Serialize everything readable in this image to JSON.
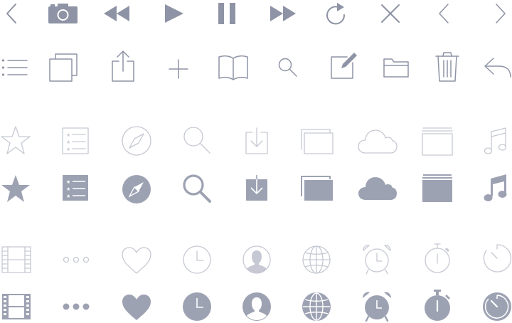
{
  "colors": {
    "toolbar_icon": "#8e93a5",
    "outline_icon": "#c6c9d3",
    "solid_icon": "#9da2b3",
    "background": "#ffffff"
  },
  "toolbar_row_1": [
    "back-chevron-icon",
    "camera-icon",
    "rewind-icon",
    "play-icon",
    "pause-icon",
    "fast-forward-icon",
    "refresh-icon",
    "close-icon",
    "chevron-left-icon",
    "chevron-right-icon"
  ],
  "toolbar_row_2": [
    "list-icon",
    "copy-icon",
    "share-icon",
    "add-icon",
    "book-icon",
    "search-icon",
    "compose-icon",
    "folder-icon",
    "trash-icon",
    "reply-icon"
  ],
  "tab_row_outline_1": [
    "star-outline-icon",
    "list-rated-outline-icon",
    "compass-outline-icon",
    "search-outline-icon",
    "download-outline-icon",
    "windows-outline-icon",
    "cloud-outline-icon",
    "stack-outline-icon",
    "music-outline-icon"
  ],
  "tab_row_filled_1": [
    "star-filled-icon",
    "list-rated-filled-icon",
    "compass-filled-icon",
    "search-filled-icon",
    "download-filled-icon",
    "windows-filled-icon",
    "cloud-filled-icon",
    "stack-filled-icon",
    "music-filled-icon"
  ],
  "tab_row_outline_2": [
    "film-outline-icon",
    "more-outline-icon",
    "heart-outline-icon",
    "clock-outline-icon",
    "contact-outline-icon",
    "globe-outline-icon",
    "alarm-outline-icon",
    "stopwatch-outline-icon",
    "timer-outline-icon"
  ],
  "tab_row_filled_2": [
    "film-filled-icon",
    "more-filled-icon",
    "heart-filled-icon",
    "clock-filled-icon",
    "contact-filled-icon",
    "globe-filled-icon",
    "alarm-filled-icon",
    "stopwatch-filled-icon",
    "timer-filled-icon"
  ]
}
